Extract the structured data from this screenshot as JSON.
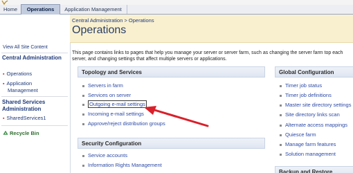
{
  "tabs": {
    "home": "Home",
    "operations": "Operations",
    "app_management": "Application Management"
  },
  "sidebar": {
    "view_all": "View All Site Content",
    "central_admin": "Central Administration",
    "items": [
      {
        "label": "Operations"
      },
      {
        "label": "Application Management"
      }
    ],
    "shared_services": "Shared Services Administration",
    "shared_items": [
      {
        "label": "SharedServices1"
      }
    ],
    "recycle_bin": "Recycle Bin"
  },
  "header": {
    "breadcrumb": "Central Administration > Operations",
    "title": "Operations"
  },
  "description": "This page contains links to pages that help you manage your server or server farm, such as changing the server farm top each server, and changing settings that affect multiple servers or applications.",
  "sections": {
    "topology": {
      "title": "Topology and Services",
      "links": [
        "Servers in farm",
        "Services on server",
        "Outgoing e-mail settings",
        "Incoming e-mail settings",
        "Approve/reject distribution groups"
      ]
    },
    "security": {
      "title": "Security Configuration",
      "links": [
        "Service accounts",
        "Information Rights Management"
      ]
    },
    "global": {
      "title": "Global Configuration",
      "links": [
        "Timer job status",
        "Timer job definitions",
        "Master site directory settings",
        "Site directory links scan",
        "Alternate access mappings",
        "Quiesce farm",
        "Manage farm features",
        "Solution management"
      ]
    },
    "backup": {
      "title": "Backup and Restore"
    }
  },
  "colors": {
    "header_bg": "#f9f0d0",
    "link": "#2b4aa6",
    "annotation_arrow": "#d9202a",
    "sidebar_bullet": "#c0282f"
  }
}
